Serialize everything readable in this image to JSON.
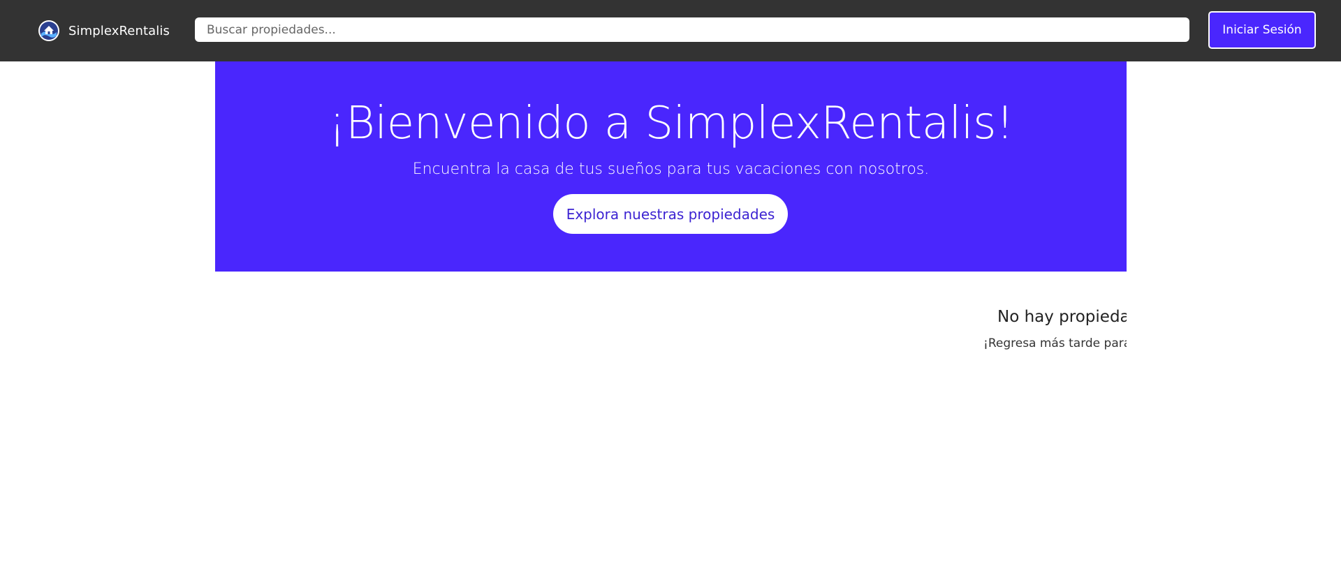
{
  "navbar": {
    "brand_name": "SimplexRentalis",
    "logo_icon": "house-wave-logo-icon",
    "search_placeholder": "Buscar propiedades...",
    "login_label": "Iniciar Sesión"
  },
  "hero": {
    "title": "¡Bienvenido a SimplexRentalis!",
    "subtitle": "Encuentra la casa de tus sueños para tus vacaciones con nosotros.",
    "cta_label": "Explora nuestras propiedades"
  },
  "properties": {
    "empty_title": "No hay propiedades disponibles",
    "empty_message": "¡Regresa más tarde para ver nuevas propiedades!"
  },
  "colors": {
    "navbar_bg": "#333333",
    "accent": "#4a26fd",
    "cta_text": "#3c23d2",
    "page_bg": "#ffffff"
  }
}
